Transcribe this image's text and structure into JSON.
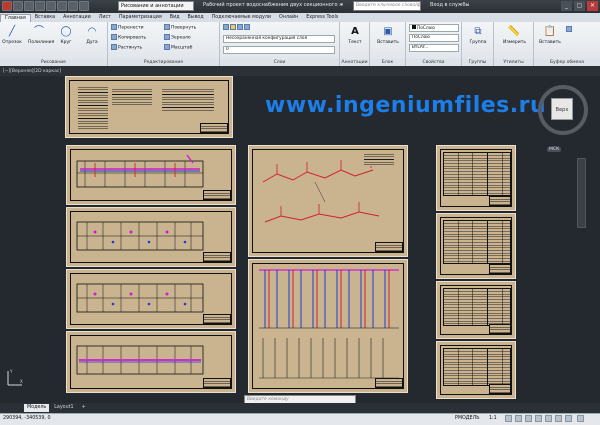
{
  "titlebar": {
    "workspace": "Рисование и аннотации",
    "document_title": "Рабочий проект водоснабжения двух секционного жилого...",
    "search_placeholder": "Введите ключевое слово/фразу",
    "signin": "Вход в службы",
    "buttons": [
      "_",
      "▢",
      "✕"
    ]
  },
  "ribbon_tabs": [
    "Главная",
    "Вставка",
    "Аннотации",
    "Лист",
    "Параметризация",
    "Вид",
    "Вывод",
    "Подключаемые модули",
    "Онлайн",
    "Express Tools"
  ],
  "ribbon": {
    "draw": {
      "label": "Рисование",
      "buttons": [
        "Отрезок",
        "Полилиния",
        "Круг",
        "Дуга"
      ]
    },
    "modify": {
      "label": "Редактирование",
      "rows": [
        [
          "Перенести",
          "Повернуть"
        ],
        [
          "Копировать",
          "Зеркало"
        ],
        [
          "Растянуть",
          "Масштаб"
        ]
      ]
    },
    "layers": {
      "label": "Слои",
      "combo1": "Несохраненная конфигурация слоя",
      "combo2": "0"
    },
    "annotation": {
      "label": "Аннотации",
      "button": "Текст"
    },
    "block": {
      "label": "Блок",
      "button": "Вставить"
    },
    "properties": {
      "label": "Свойства",
      "rows": [
        "ПоСлою",
        "ПоСлою",
        "BYLAY..."
      ]
    },
    "groups": {
      "label": "Группы",
      "button": "Группа"
    },
    "utilities": {
      "label": "Утилиты",
      "button": "Измерить"
    },
    "clipboard": {
      "label": "Буфер обмена",
      "button": "Вставить"
    }
  },
  "viewport": {
    "view_label": "[−][Верхняя][2D каркас]",
    "watermark": "www.ingeniumfiles.ru",
    "viewcube_face": "Верх",
    "wcs": "МСК"
  },
  "command_line": {
    "placeholder": "Введите команду"
  },
  "layout_tabs": [
    "Модель",
    "Layout1",
    "+"
  ],
  "statusbar": {
    "coordinates": "290394, -340539, 0",
    "mode": "РМОДЕЛЬ",
    "scale": "1:1"
  },
  "colors": {
    "paper": "#c9b48f",
    "background": "#24292f",
    "accent_pipe_red": "#d2202a",
    "accent_pipe_blue": "#1f3bd6",
    "accent_pipe_magenta": "#d21ad2",
    "watermark": "#1d7ee8"
  }
}
